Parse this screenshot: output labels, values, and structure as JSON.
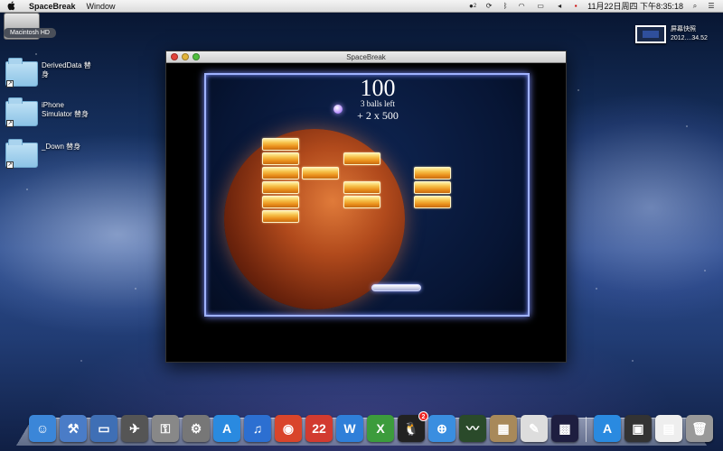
{
  "menubar": {
    "app_name": "SpaceBreak",
    "menus": [
      "Window"
    ],
    "status_icons": [
      "qq-status-icon",
      "sync-icon",
      "bluetooth-icon",
      "wifi-icon",
      "battery-icon",
      "volume-icon",
      "keyboard-flag-icon"
    ],
    "qq_count": "2",
    "clock": "11月22日周四 下午8:35:18"
  },
  "desktop": {
    "drive_label": "Macintosh HD",
    "items": [
      {
        "label": "DerivedData 替身"
      },
      {
        "label": "iPhone Simulator 替身"
      },
      {
        "label": "_Down 替身"
      }
    ],
    "screenshot": {
      "title": "屏幕快照",
      "subtitle": "2012....34.52"
    }
  },
  "window": {
    "title": "SpaceBreak"
  },
  "game": {
    "score": "100",
    "balls_left": "3 balls left",
    "bonus": "+ 2 x 500",
    "bricks": [
      {
        "col": 0,
        "row": 0
      },
      {
        "col": 0,
        "row": 1
      },
      {
        "col": 0,
        "row": 2
      },
      {
        "col": 0,
        "row": 3
      },
      {
        "col": 0,
        "row": 4
      },
      {
        "col": 0,
        "row": 5
      },
      {
        "col": 1,
        "row": 2
      },
      {
        "col": 2,
        "row": 1
      },
      {
        "col": 2,
        "row": 3
      },
      {
        "col": 2,
        "row": 4
      },
      {
        "col": 3,
        "row": 2
      },
      {
        "col": 3,
        "row": 3
      },
      {
        "col": 3,
        "row": 4
      }
    ]
  },
  "dock": {
    "apps": [
      {
        "name": "finder-icon",
        "glyph": "☺",
        "color": "#3b86d8"
      },
      {
        "name": "xcode-icon",
        "glyph": "⚒",
        "color": "#4a7cc7"
      },
      {
        "name": "preview-icon",
        "glyph": "▭",
        "color": "#3f6fb5"
      },
      {
        "name": "launchpad-icon",
        "glyph": "✈",
        "color": "#555"
      },
      {
        "name": "keychain-icon",
        "glyph": "⚿",
        "color": "#888"
      },
      {
        "name": "system-preferences-icon",
        "glyph": "⚙",
        "color": "#777"
      },
      {
        "name": "app-store-icon",
        "glyph": "A",
        "color": "#2a8ae0"
      },
      {
        "name": "itunes-icon",
        "glyph": "♫",
        "color": "#2c6fd1"
      },
      {
        "name": "chrome-icon",
        "glyph": "◉",
        "color": "#d9452b"
      },
      {
        "name": "calendar-icon",
        "glyph": "22",
        "color": "#d23b30"
      },
      {
        "name": "word-icon",
        "glyph": "W",
        "color": "#2f7fd9"
      },
      {
        "name": "excel-icon",
        "glyph": "X",
        "color": "#3c9c3c"
      },
      {
        "name": "qq-icon",
        "glyph": "🐧",
        "color": "#222",
        "badge": "2"
      },
      {
        "name": "safari-icon",
        "glyph": "⊕",
        "color": "#3a8ee0"
      },
      {
        "name": "activity-monitor-icon",
        "glyph": "〰",
        "color": "#2a4a2a"
      },
      {
        "name": "archive-utility-icon",
        "glyph": "▦",
        "color": "#a8895a"
      },
      {
        "name": "textedit-icon",
        "glyph": "✎",
        "color": "#ddd"
      },
      {
        "name": "spacebreak-icon",
        "glyph": "▩",
        "color": "#1e1e40"
      }
    ],
    "stacks": [
      {
        "name": "applications-stack-icon",
        "glyph": "A",
        "color": "#2a8ae0"
      },
      {
        "name": "downloads-stack-icon",
        "glyph": "▣",
        "color": "#333"
      },
      {
        "name": "document-stack-icon",
        "glyph": "▤",
        "color": "#eee"
      },
      {
        "name": "trash-icon",
        "glyph": "🗑",
        "color": "#999"
      }
    ]
  }
}
